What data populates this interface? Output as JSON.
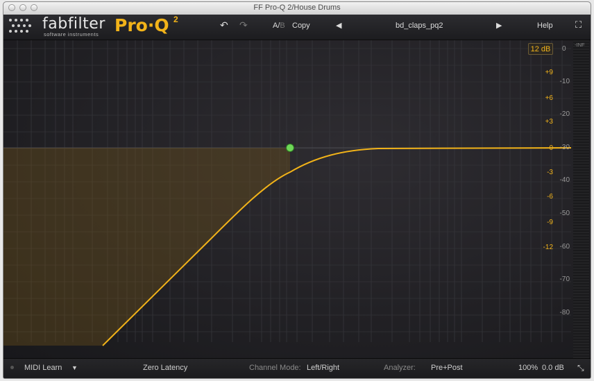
{
  "window": {
    "title": "FF Pro-Q 2/House Drums"
  },
  "header": {
    "brand": "fabfilter",
    "brand_sub": "software instruments",
    "product": "Pro·Q",
    "product_sup": "2",
    "undo_icon": "undo-arrow",
    "redo_icon": "redo-arrow",
    "ab_a": "A",
    "ab_sep": "/",
    "ab_b": "B",
    "copy_label": "Copy",
    "prev_icon": "triangle-left",
    "preset_name": "bd_claps_pq2",
    "next_icon": "triangle-right",
    "help_label": "Help",
    "fullscreen_icon": "expand-corners"
  },
  "display": {
    "scale_label": "12 dB",
    "meter_zero": "0",
    "meter_inf": "-INF",
    "gain_scale": [
      "+9",
      "+6",
      "+3",
      "0",
      "-3",
      "-6",
      "-9",
      "-12"
    ],
    "analyzer_scale": [
      "-10",
      "-20",
      "-30",
      "-40",
      "-50",
      "-60",
      "-70",
      "-80"
    ],
    "band_color": "#f2b319",
    "node_color": "#6fd858"
  },
  "footer": {
    "midi_learn": "MIDI Learn",
    "latency": "Zero Latency",
    "channel_mode_label": "Channel Mode:",
    "channel_mode_value": "Left/Right",
    "analyzer_label": "Analyzer:",
    "analyzer_value": "Pre+Post",
    "zoom": "100%",
    "output_gain": "0.0 dB"
  }
}
